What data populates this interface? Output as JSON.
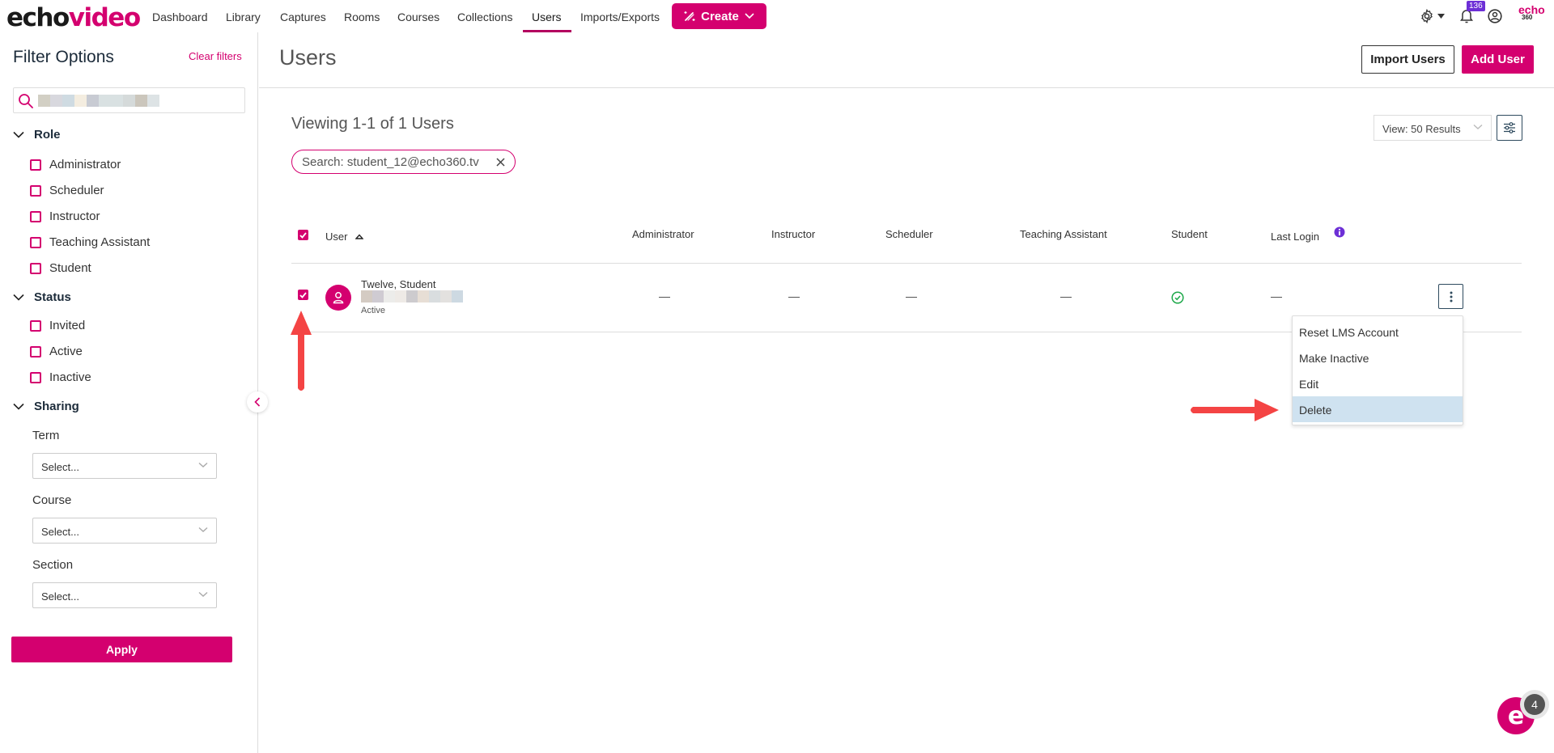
{
  "app": {
    "logo_part1": "echo",
    "logo_part2": "video",
    "brand_color": "#d4006f",
    "right_logo_top": "echo",
    "right_logo_bottom": "360"
  },
  "nav": {
    "items": [
      {
        "label": "Dashboard"
      },
      {
        "label": "Library"
      },
      {
        "label": "Captures"
      },
      {
        "label": "Rooms"
      },
      {
        "label": "Courses"
      },
      {
        "label": "Collections"
      },
      {
        "label": "Users",
        "active": true
      },
      {
        "label": "Imports/Exports"
      }
    ],
    "create_label": "Create",
    "notification_count": "136",
    "icons": [
      "gear-icon",
      "bell-icon",
      "user-circle-icon"
    ]
  },
  "sidebar": {
    "title": "Filter Options",
    "clear_label": "Clear filters",
    "search_value": "",
    "role": {
      "title": "Role",
      "options": [
        "Administrator",
        "Scheduler",
        "Instructor",
        "Teaching Assistant",
        "Student"
      ]
    },
    "status": {
      "title": "Status",
      "options": [
        "Invited",
        "Active",
        "Inactive"
      ]
    },
    "sharing": {
      "title": "Sharing",
      "fields": [
        {
          "label": "Term",
          "value": "Select..."
        },
        {
          "label": "Course",
          "value": "Select..."
        },
        {
          "label": "Section",
          "value": "Select..."
        }
      ]
    },
    "apply_label": "Apply"
  },
  "main": {
    "title": "Users",
    "import_label": "Import Users",
    "add_label": "Add User",
    "viewing_text": "Viewing 1-1 of 1 Users",
    "search_chip": "Search: student_12@echo360.tv",
    "view_select": "View: 50 Results",
    "table": {
      "columns": [
        "User",
        "Administrator",
        "Instructor",
        "Scheduler",
        "Teaching Assistant",
        "Student",
        "Last Login"
      ],
      "select_all_checked": true,
      "rows": [
        {
          "checked": true,
          "name": "Twelve, Student",
          "email_redacted": true,
          "status": "Active",
          "administrator": "—",
          "instructor": "—",
          "scheduler": "—",
          "teaching_assistant": "—",
          "student": "check",
          "last_login": "—"
        }
      ]
    },
    "row_menu": {
      "items": [
        "Reset LMS Account",
        "Make Inactive",
        "Edit",
        "Delete"
      ],
      "highlighted": "Delete"
    }
  },
  "chat": {
    "letter": "e",
    "badge": "4"
  }
}
